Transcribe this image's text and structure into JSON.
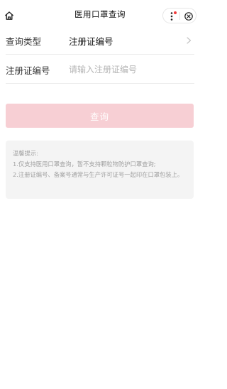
{
  "nav": {
    "title": "医用口罩查询",
    "home_icon": "home-icon",
    "more_icon": "more-dots-icon",
    "close_icon": "close-circle-icon"
  },
  "form": {
    "type_row": {
      "label": "查询类型",
      "value": "注册证编号",
      "icon": "chevron-right-icon"
    },
    "reg_row": {
      "label": "注册证编号",
      "placeholder": "请输入注册证编号",
      "value": ""
    }
  },
  "query_button": {
    "label": "查询",
    "color": "#f7cfd4"
  },
  "tips": {
    "heading": "温馨提示:",
    "line1": "1.仅支持医用口罩查询，暂不支持颗粒物防护口罩查询;",
    "line2": "2.注册证编号、备案号通常与生产许可证号一起印在口罩包装上。"
  },
  "colors": {
    "accent_disabled": "#f7cfd4",
    "notification_dot": "#f03a3a"
  }
}
